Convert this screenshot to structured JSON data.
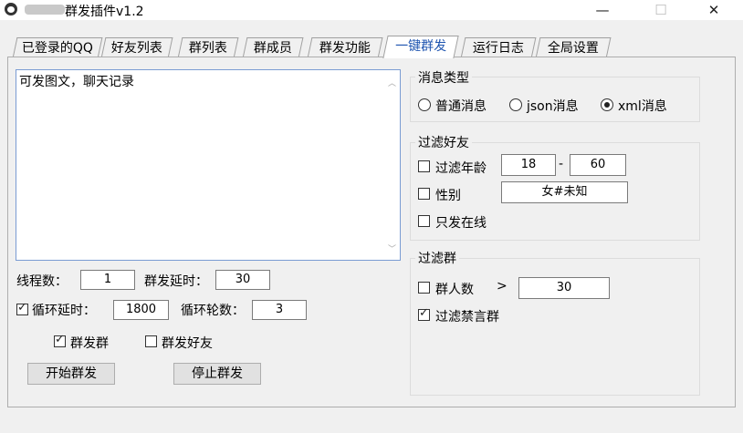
{
  "window": {
    "title": "群发插件v1.2",
    "minimize": "—",
    "maximize": "☐",
    "close": "✕"
  },
  "tabs": [
    {
      "label": "已登录的QQ"
    },
    {
      "label": "好友列表"
    },
    {
      "label": "群列表"
    },
    {
      "label": "群成员"
    },
    {
      "label": "群发功能"
    },
    {
      "label": "一键群发",
      "active": true
    },
    {
      "label": "运行日志"
    },
    {
      "label": "全局设置"
    }
  ],
  "message": {
    "content": "可发图文，聊天记录"
  },
  "settings": {
    "threads_label": "线程数：",
    "threads_value": "1",
    "delay_label": "群发延时：",
    "delay_value": "30",
    "loop_delay_label": "循环延时：",
    "loop_delay_value": "1800",
    "loop_delay_checked": true,
    "loop_rounds_label": "循环轮数：",
    "loop_rounds_value": "3",
    "send_group_label": "群发群",
    "send_group_checked": true,
    "send_friend_label": "群发好友",
    "send_friend_checked": false,
    "start_button": "开始群发",
    "stop_button": "停止群发"
  },
  "message_type": {
    "title": "消息类型",
    "options": [
      "普通消息",
      "json消息",
      "xml消息"
    ],
    "selected": "xml消息"
  },
  "filter_friends": {
    "title": "过滤好友",
    "age_label": "过滤年龄",
    "age_min": "18",
    "age_sep": "-",
    "age_max": "60",
    "gender_label": "性别",
    "gender_value": "女#未知",
    "online_label": "只发在线"
  },
  "filter_groups": {
    "title": "过滤群",
    "member_count_label": "群人数",
    "member_count_op": ">",
    "member_count_value": "30",
    "muted_label": "过滤禁言群",
    "muted_checked": true
  }
}
